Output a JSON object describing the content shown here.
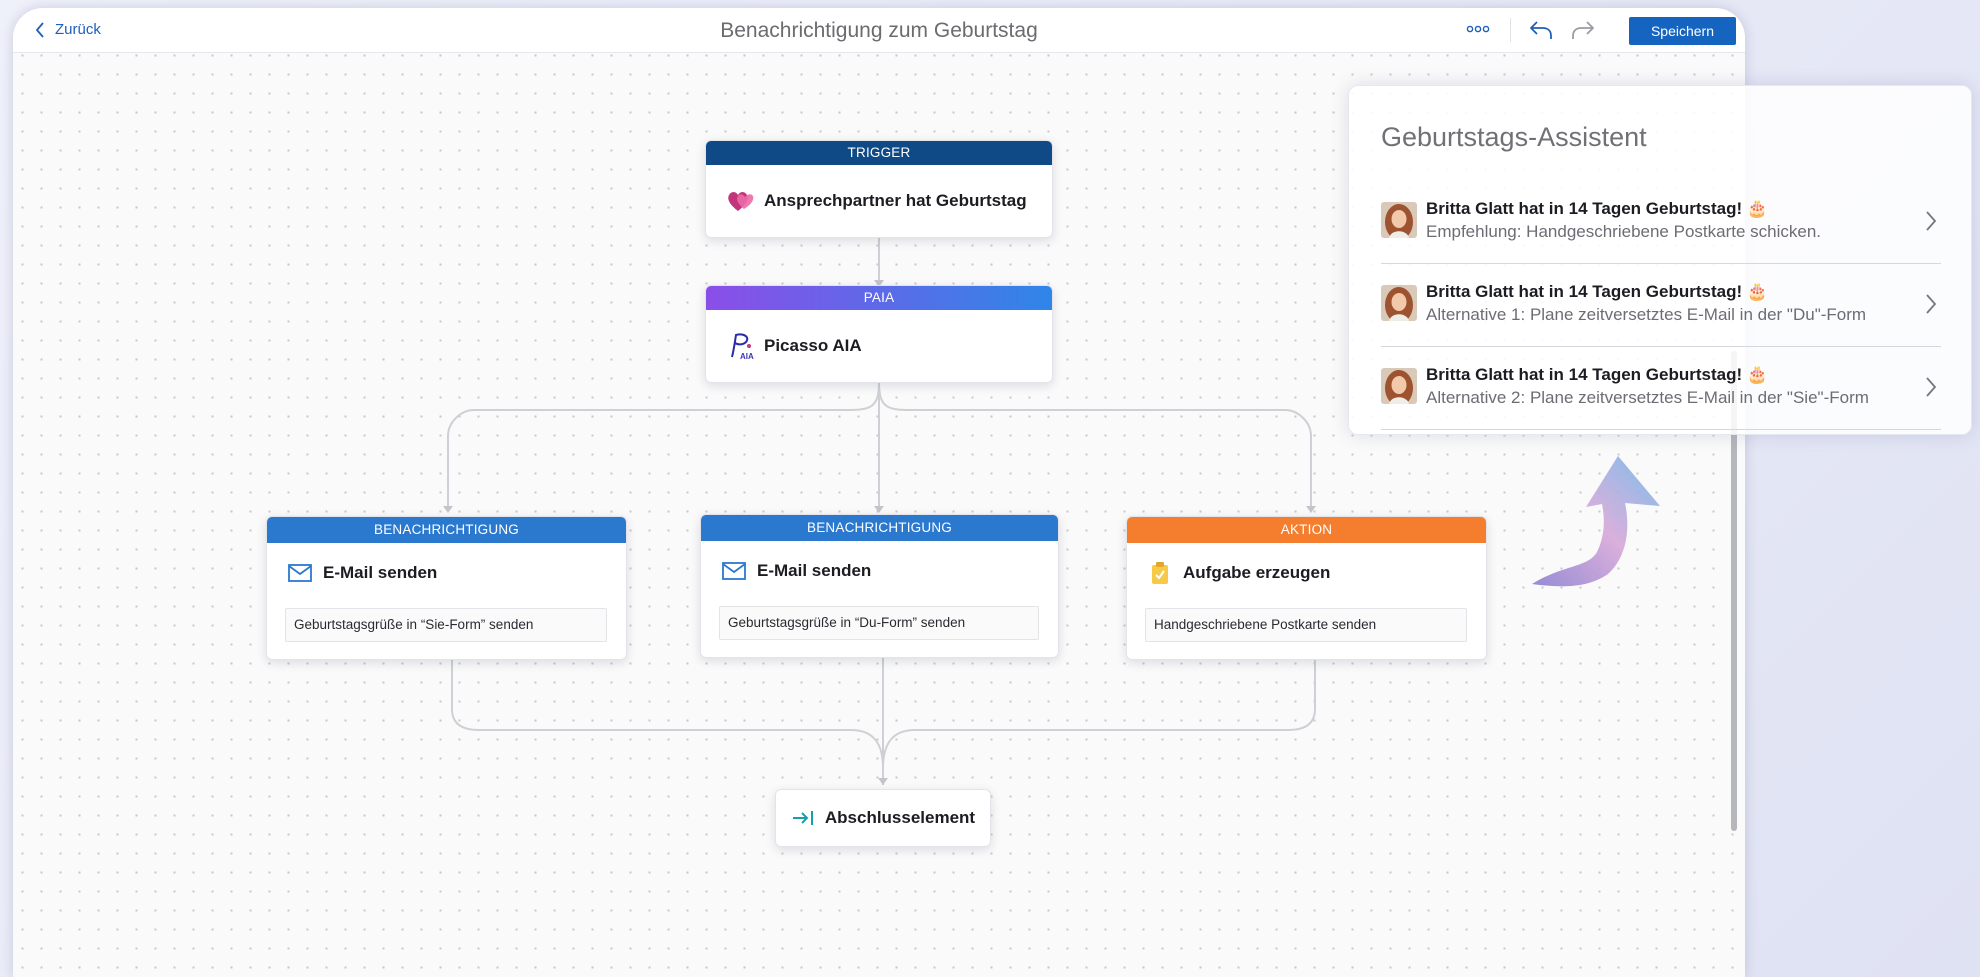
{
  "header": {
    "back_label": "Zurück",
    "title": "Benachrichtigung zum Geburtstag",
    "more_icon": "more-dots-icon",
    "undo_icon": "undo-icon",
    "redo_icon": "redo-icon",
    "save_label": "Speichern"
  },
  "workflow": {
    "trigger": {
      "header": "TRIGGER",
      "label": "Ansprechpartner hat Geburtstag",
      "icon": "birthday-heart-icon"
    },
    "paia": {
      "header": "PAIA",
      "label": "Picasso AIA",
      "icon": "picasso-aia-logo"
    },
    "branches": [
      {
        "header": "BENACHRICHTIGUNG",
        "label": "E-Mail senden",
        "icon": "mail-icon",
        "description": "Geburtstagsgrüße in “Sie-Form” senden"
      },
      {
        "header": "BENACHRICHTIGUNG",
        "label": "E-Mail senden",
        "icon": "mail-icon",
        "description": "Geburtstagsgrüße in “Du-Form” senden"
      },
      {
        "header": "AKTION",
        "label": "Aufgabe erzeugen",
        "icon": "task-clipboard-icon",
        "description": "Handgeschriebene Postkarte senden"
      }
    ],
    "end": {
      "label": "Abschlusselement",
      "icon": "exit-arrow-icon"
    }
  },
  "assistant": {
    "title": "Geburtstags-Assistent",
    "suggestions": [
      {
        "title": "Britta Glatt hat in 14 Tagen Geburtstag! 🎂",
        "text": "Empfehlung: Handgeschriebene Postkarte schicken."
      },
      {
        "title": "Britta Glatt hat in 14 Tagen Geburtstag! 🎂",
        "text": "Alternative 1: Plane zeitversetztes E-Mail in der \"Du\"-Form"
      },
      {
        "title": "Britta Glatt hat in 14 Tagen Geburtstag! 🎂",
        "text": "Alternative 2: Plane zeitversetztes E-Mail in der \"Sie\"-Form"
      }
    ]
  },
  "colors": {
    "trigger": "#0f4a87",
    "paia_start": "#8b4ee8",
    "paia_end": "#2f86e8",
    "notification": "#2b78cf",
    "action": "#f47e2e",
    "save_button": "#1565c0",
    "link": "#1f5fb8"
  }
}
